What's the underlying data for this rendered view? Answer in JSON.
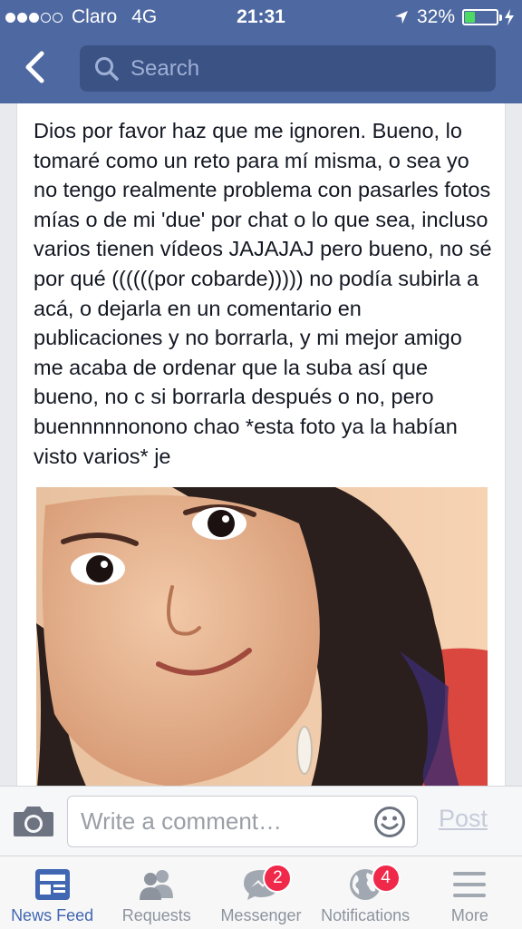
{
  "status_bar": {
    "carrier": "Claro",
    "network": "4G",
    "time": "21:31",
    "battery": "32%",
    "battery_level": 0.32,
    "signal_bars": 3
  },
  "nav": {
    "search_placeholder": "Search"
  },
  "post": {
    "text": "Dios por favor haz que me ignoren. Bueno, lo tomaré como un reto para mí misma, o sea yo no tengo realmente problema con pasarles fotos mías o de mi 'due' por chat o lo que sea, incluso varios tienen vídeos JAJAJAJ pero bueno, no sé por qué ((((((por cobarde))))) no podía subirla a acá, o dejarla en un comentario en publicaciones y no borrarla, y mi mejor amigo me acaba de ordenar que la suba así que bueno, no c si borrarla después o no, pero buennnnnonono chao *esta foto ya la habían visto varios* je"
  },
  "comment_bar": {
    "placeholder": "Write a comment…",
    "post_label": "Post"
  },
  "tabs": [
    {
      "label": "News Feed",
      "icon": "news-feed-icon",
      "active": true
    },
    {
      "label": "Requests",
      "icon": "friend-requests-icon",
      "active": false
    },
    {
      "label": "Messenger",
      "icon": "messenger-icon",
      "badge": "2",
      "active": false
    },
    {
      "label": "Notifications",
      "icon": "globe-icon",
      "badge": "4",
      "active": false
    },
    {
      "label": "More",
      "icon": "menu-icon",
      "active": false
    }
  ],
  "colors": {
    "header": "#4e69a2",
    "active_tab": "#4267b2",
    "badge": "#f02849",
    "battery_fill": "#4cd964"
  }
}
